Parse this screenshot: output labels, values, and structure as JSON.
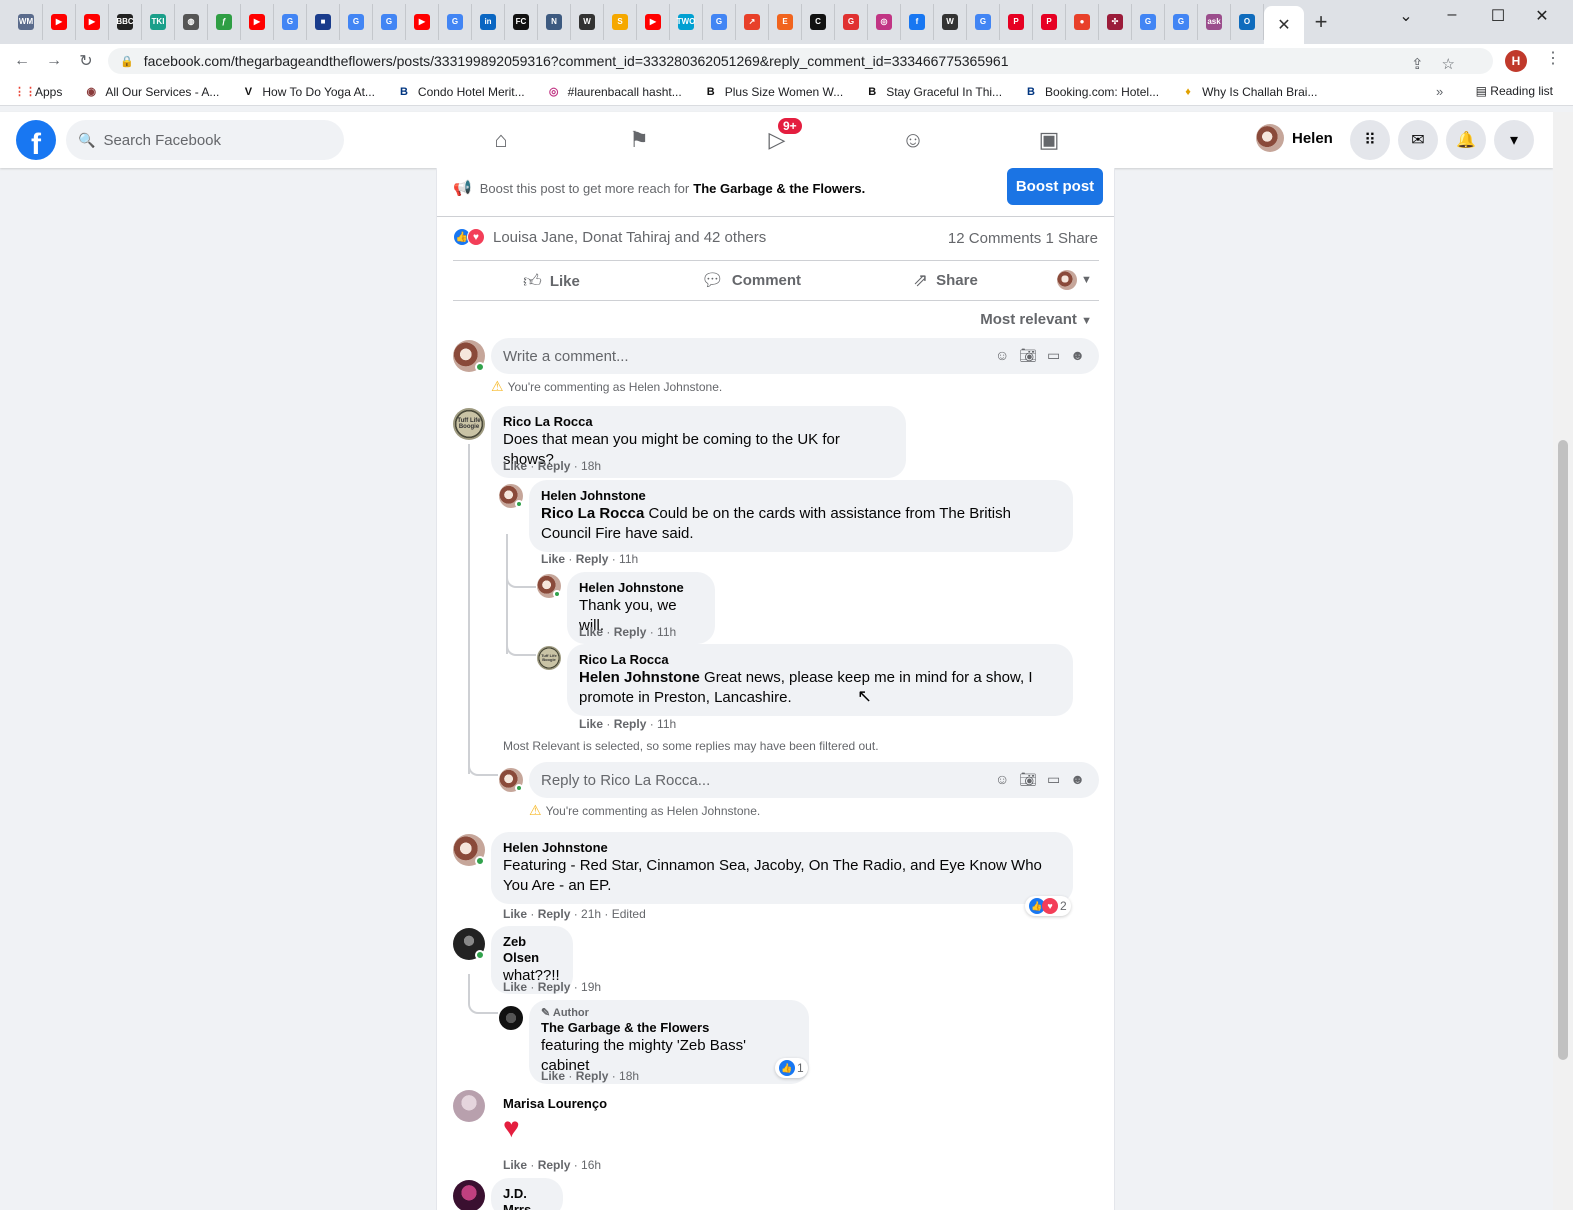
{
  "browser": {
    "tab_close": "✕",
    "new_tab": "+",
    "url": "facebook.com/thegarbageandtheflowers/posts/333199892059316?comment_id=333280362051269&reply_comment_id=333466775365961",
    "profile_initial": "H",
    "tab_favicons": [
      {
        "icon": "wm-icon",
        "label": "WM",
        "color": "#5a6b8c"
      },
      {
        "icon": "youtube-icon",
        "label": "▶",
        "color": "#ff0000"
      },
      {
        "icon": "youtube-icon",
        "label": "▶",
        "color": "#ff0000"
      },
      {
        "icon": "bbc-icon",
        "label": "BBC",
        "color": "#222222"
      },
      {
        "icon": "tki-icon",
        "label": "TKI",
        "color": "#1a9f8a"
      },
      {
        "icon": "globe-icon",
        "label": "◍",
        "color": "#555555"
      },
      {
        "icon": "leaf-icon",
        "label": "ƒ",
        "color": "#2f9e44"
      },
      {
        "icon": "youtube-icon",
        "label": "▶",
        "color": "#ff0000"
      },
      {
        "icon": "google-icon",
        "label": "G",
        "color": "#4285f4"
      },
      {
        "icon": "flag-icon",
        "label": "■",
        "color": "#1a3c8c"
      },
      {
        "icon": "google-icon",
        "label": "G",
        "color": "#4285f4"
      },
      {
        "icon": "google-icon",
        "label": "G",
        "color": "#4285f4"
      },
      {
        "icon": "youtube-icon",
        "label": "▶",
        "color": "#ff0000"
      },
      {
        "icon": "google-icon",
        "label": "G",
        "color": "#4285f4"
      },
      {
        "icon": "linkedin-icon",
        "label": "in",
        "color": "#0a66c2"
      },
      {
        "icon": "fc-icon",
        "label": "FC",
        "color": "#111111"
      },
      {
        "icon": "news-icon",
        "label": "N",
        "color": "#3d5a80"
      },
      {
        "icon": "wikipedia-icon",
        "label": "W",
        "color": "#333333"
      },
      {
        "icon": "s-icon",
        "label": "S",
        "color": "#f5a800"
      },
      {
        "icon": "youtube-icon",
        "label": "▶",
        "color": "#ff0000"
      },
      {
        "icon": "two-icon",
        "label": "TWO",
        "color": "#00a0d2"
      },
      {
        "icon": "google-icon",
        "label": "G",
        "color": "#4285f4"
      },
      {
        "icon": "trend-icon",
        "label": "↗",
        "color": "#e8402a"
      },
      {
        "icon": "etsy-icon",
        "label": "E",
        "color": "#f1641e"
      },
      {
        "icon": "c-icon",
        "label": "C",
        "color": "#111111"
      },
      {
        "icon": "g-red-icon",
        "label": "G",
        "color": "#e03131"
      },
      {
        "icon": "instagram-icon",
        "label": "◎",
        "color": "#c13584"
      },
      {
        "icon": "facebook-icon",
        "label": "f",
        "color": "#1877f2"
      },
      {
        "icon": "wikipedia-icon",
        "label": "W",
        "color": "#333333"
      },
      {
        "icon": "google-icon",
        "label": "G",
        "color": "#4285f4"
      },
      {
        "icon": "pinterest-icon",
        "label": "P",
        "color": "#e60023"
      },
      {
        "icon": "pinterest-icon",
        "label": "P",
        "color": "#e60023"
      },
      {
        "icon": "record-icon",
        "label": "●",
        "color": "#e8402a"
      },
      {
        "icon": "aperture-icon",
        "label": "✣",
        "color": "#9b1c3a"
      },
      {
        "icon": "google-icon",
        "label": "G",
        "color": "#4285f4"
      },
      {
        "icon": "google-icon",
        "label": "G",
        "color": "#4285f4"
      },
      {
        "icon": "ask-icon",
        "label": "ask",
        "color": "#9b4d8c"
      },
      {
        "icon": "outlook-icon",
        "label": "O",
        "color": "#0f6cbd"
      }
    ],
    "bookmarks": [
      {
        "icon": "apps-grid-icon",
        "glyph": "⋮⋮",
        "color": "#ea4335",
        "label": "Apps"
      },
      {
        "icon": "site-icon",
        "glyph": "◉",
        "color": "#8a3b3b",
        "label": "All Our Services - A..."
      },
      {
        "icon": "v-icon",
        "glyph": "V",
        "color": "#111111",
        "label": "How To Do Yoga At..."
      },
      {
        "icon": "booking-icon",
        "glyph": "B",
        "color": "#003580",
        "label": "Condo Hotel Merit..."
      },
      {
        "icon": "instagram-icon",
        "glyph": "◎",
        "color": "#c13584",
        "label": "#laurenbacall hasht..."
      },
      {
        "icon": "b-icon",
        "glyph": "B",
        "color": "#111111",
        "label": "Plus Size Women W..."
      },
      {
        "icon": "b-icon",
        "glyph": "B",
        "color": "#111111",
        "label": "Stay Graceful In Thi..."
      },
      {
        "icon": "booking-icon",
        "glyph": "B",
        "color": "#003580",
        "label": "Booking.com: Hotel..."
      },
      {
        "icon": "flame-icon",
        "glyph": "♦",
        "color": "#e0a000",
        "label": "Why Is Challah Brai..."
      }
    ],
    "bookmarks_more": "»",
    "reading_list": "Reading list"
  },
  "fb": {
    "search_placeholder": "Search Facebook",
    "watch_badge": "9+",
    "user_name": "Helen"
  },
  "post": {
    "boost_text": "Boost this post to get more reach for",
    "page_name": "The Garbage & the Flowers.",
    "boost_button": "Boost post",
    "reactors": "Louisa Jane, Donat Tahiraj and 42 others",
    "counts": "12 Comments  1 Share",
    "like": "Like",
    "comment": "Comment",
    "share": "Share",
    "sort": "Most relevant",
    "write_placeholder": "Write a comment...",
    "commenting_as": "You're commenting as Helen Johnstone.",
    "filtered_note": "Most Relevant is selected, so some replies may have been filtered out.",
    "reply_placeholder": "Reply to Rico La Rocca...",
    "rico_avatar_text": "Tuff Life Boogie"
  },
  "comments": {
    "c1": {
      "name": "Rico La Rocca",
      "text": "Does that mean you might be coming to the UK for shows?",
      "time": "18h"
    },
    "r1": {
      "name": "Helen Johnstone",
      "tag": "Rico La Rocca",
      "text": " Could be on the cards with assistance from The British Council Fire have said.",
      "time": "11h"
    },
    "r2": {
      "name": "Helen Johnstone",
      "text": "Thank you, we will.",
      "time": "11h"
    },
    "r3": {
      "name": "Rico La Rocca",
      "tag": "Helen Johnstone",
      "text": " Great news, please keep me in mind for a show, I promote in Preston, Lancashire.",
      "time": "11h"
    },
    "c2": {
      "name": "Helen Johnstone",
      "text": "Featuring - Red Star, Cinnamon Sea, Jacoby, On The Radio, and Eye Know Who You Are - an EP.",
      "time": "21h",
      "edited": "Edited",
      "reactions": "2"
    },
    "c3": {
      "name": "Zeb Olsen",
      "text": "what??!!",
      "time": "19h"
    },
    "r4": {
      "author_label": "Author",
      "name": "The Garbage & the Flowers",
      "text": "featuring the mighty 'Zeb Bass' cabinet",
      "time": "18h",
      "reactions": "1"
    },
    "c4": {
      "name": "Marisa Lourenço",
      "time": "16h"
    },
    "c5": {
      "name": "J.D. Mrrs"
    }
  },
  "labels": {
    "like": "Like",
    "reply": "Reply",
    "sep": " · "
  }
}
